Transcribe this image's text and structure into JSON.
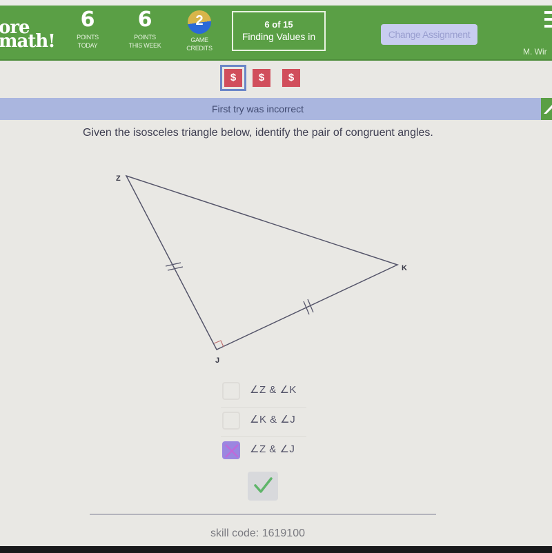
{
  "header": {
    "logo_line1": "ore",
    "logo_line2": "math!",
    "stats": [
      {
        "value": "6",
        "label_line1": "POINTS",
        "label_line2": "TODAY"
      },
      {
        "value": "6",
        "label_line1": "POINTS",
        "label_line2": "THIS WEEK"
      },
      {
        "value": "2",
        "label_line1": "GAME",
        "label_line2": "CREDITS"
      }
    ],
    "assignment_progress": "6 of 15",
    "assignment_title": "Finding Values in",
    "change_assignment_label": "Change Assignment",
    "user_name": "M. Wir",
    "colors": {
      "header_bg": "#5a9f45",
      "coin": "#d14e5c",
      "status_bar": "#aab6df",
      "checked": "#9b86e0"
    }
  },
  "coins": [
    {
      "symbol": "$",
      "selected": true
    },
    {
      "symbol": "$",
      "selected": false
    },
    {
      "symbol": "$",
      "selected": false
    }
  ],
  "status": {
    "message": "First try was incorrect"
  },
  "question": {
    "text": "Given the isosceles triangle below, identify the pair of congruent angles."
  },
  "diagram": {
    "vertices": {
      "Z": "Z",
      "K": "K",
      "J": "J"
    },
    "right_angle_at": "J",
    "congruent_sides": [
      "ZJ",
      "JK"
    ]
  },
  "choices": [
    {
      "label": "∠Z & ∠K",
      "checked": false
    },
    {
      "label": "∠K & ∠J",
      "checked": false
    },
    {
      "label": "∠Z & ∠J",
      "checked": true
    }
  ],
  "submit": {
    "icon": "checkmark-icon"
  },
  "footer": {
    "skill_code": "skill code: 1619100"
  }
}
